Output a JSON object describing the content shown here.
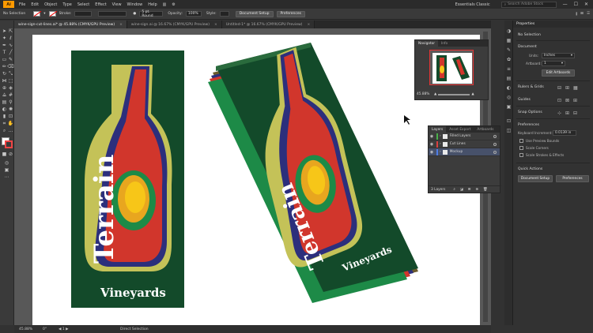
{
  "app": {
    "logo": "Ai",
    "workspace": "Essentials Classic",
    "search_placeholder": "Search Adobe Stock"
  },
  "menu": [
    "File",
    "Edit",
    "Object",
    "Type",
    "Select",
    "Effect",
    "View",
    "Window",
    "Help"
  ],
  "control_bar": {
    "selection": "No Selection",
    "stroke_label": "Stroke:",
    "brush": "5 pt. Round",
    "opacity_label": "Opacity:",
    "opacity_value": "100%",
    "style_label": "Style:",
    "document_setup": "Document Setup",
    "preferences": "Preferences"
  },
  "tabs": [
    {
      "label": "wine-sign-cut-lines.ai* @ 45.88% (CMYK/GPU Preview)",
      "active": true
    },
    {
      "label": "wine-sign.ai @ 16.67% (CMYK/GPU Preview)",
      "active": false
    },
    {
      "label": "Untitled-1* @ 16.67% (CMYK/GPU Preview)",
      "active": false
    }
  ],
  "artwork": {
    "title": "Terrain",
    "subtitle": "Vineyards",
    "colors": {
      "green": "#134a2a",
      "red": "#d1362c",
      "navy": "#2c2f7c",
      "olive": "#c4c258",
      "orange": "#e8a61f",
      "yellow": "#f7c618"
    }
  },
  "status": {
    "zoom": "45.88%",
    "tool": "Direct Selection"
  },
  "navigator": {
    "tabs": [
      "Navigator",
      "Info"
    ],
    "zoom": "45.88%"
  },
  "layers": {
    "tabs": [
      "Layers",
      "Asset Export",
      "Artboards"
    ],
    "items": [
      {
        "name": "Filled Layers",
        "color": "#4ab04a"
      },
      {
        "name": "Cut Lines",
        "color": "#d94141"
      },
      {
        "name": "Mockup",
        "color": "#4f7de5"
      }
    ],
    "count": "3 Layers"
  },
  "properties": {
    "header": "Properties",
    "selection": "No Selection",
    "document": "Document",
    "units_label": "Units:",
    "units_value": "Inches",
    "artboard_label": "Artboard:",
    "artboard_value": "1",
    "edit_artboards": "Edit Artboards",
    "rulers": "Rulers & Grids",
    "guides": "Guides",
    "snap": "Snap Options",
    "preferences": "Preferences",
    "keyboard_label": "Keyboard Increment:",
    "keyboard_value": "0.0139 in",
    "use_preview": "Use Preview Bounds",
    "scale_corners": "Scale Corners",
    "scale_strokes": "Scale Strokes & Effects",
    "quick_actions": "Quick Actions",
    "document_setup": "Document Setup",
    "qa_preferences": "Preferences"
  }
}
